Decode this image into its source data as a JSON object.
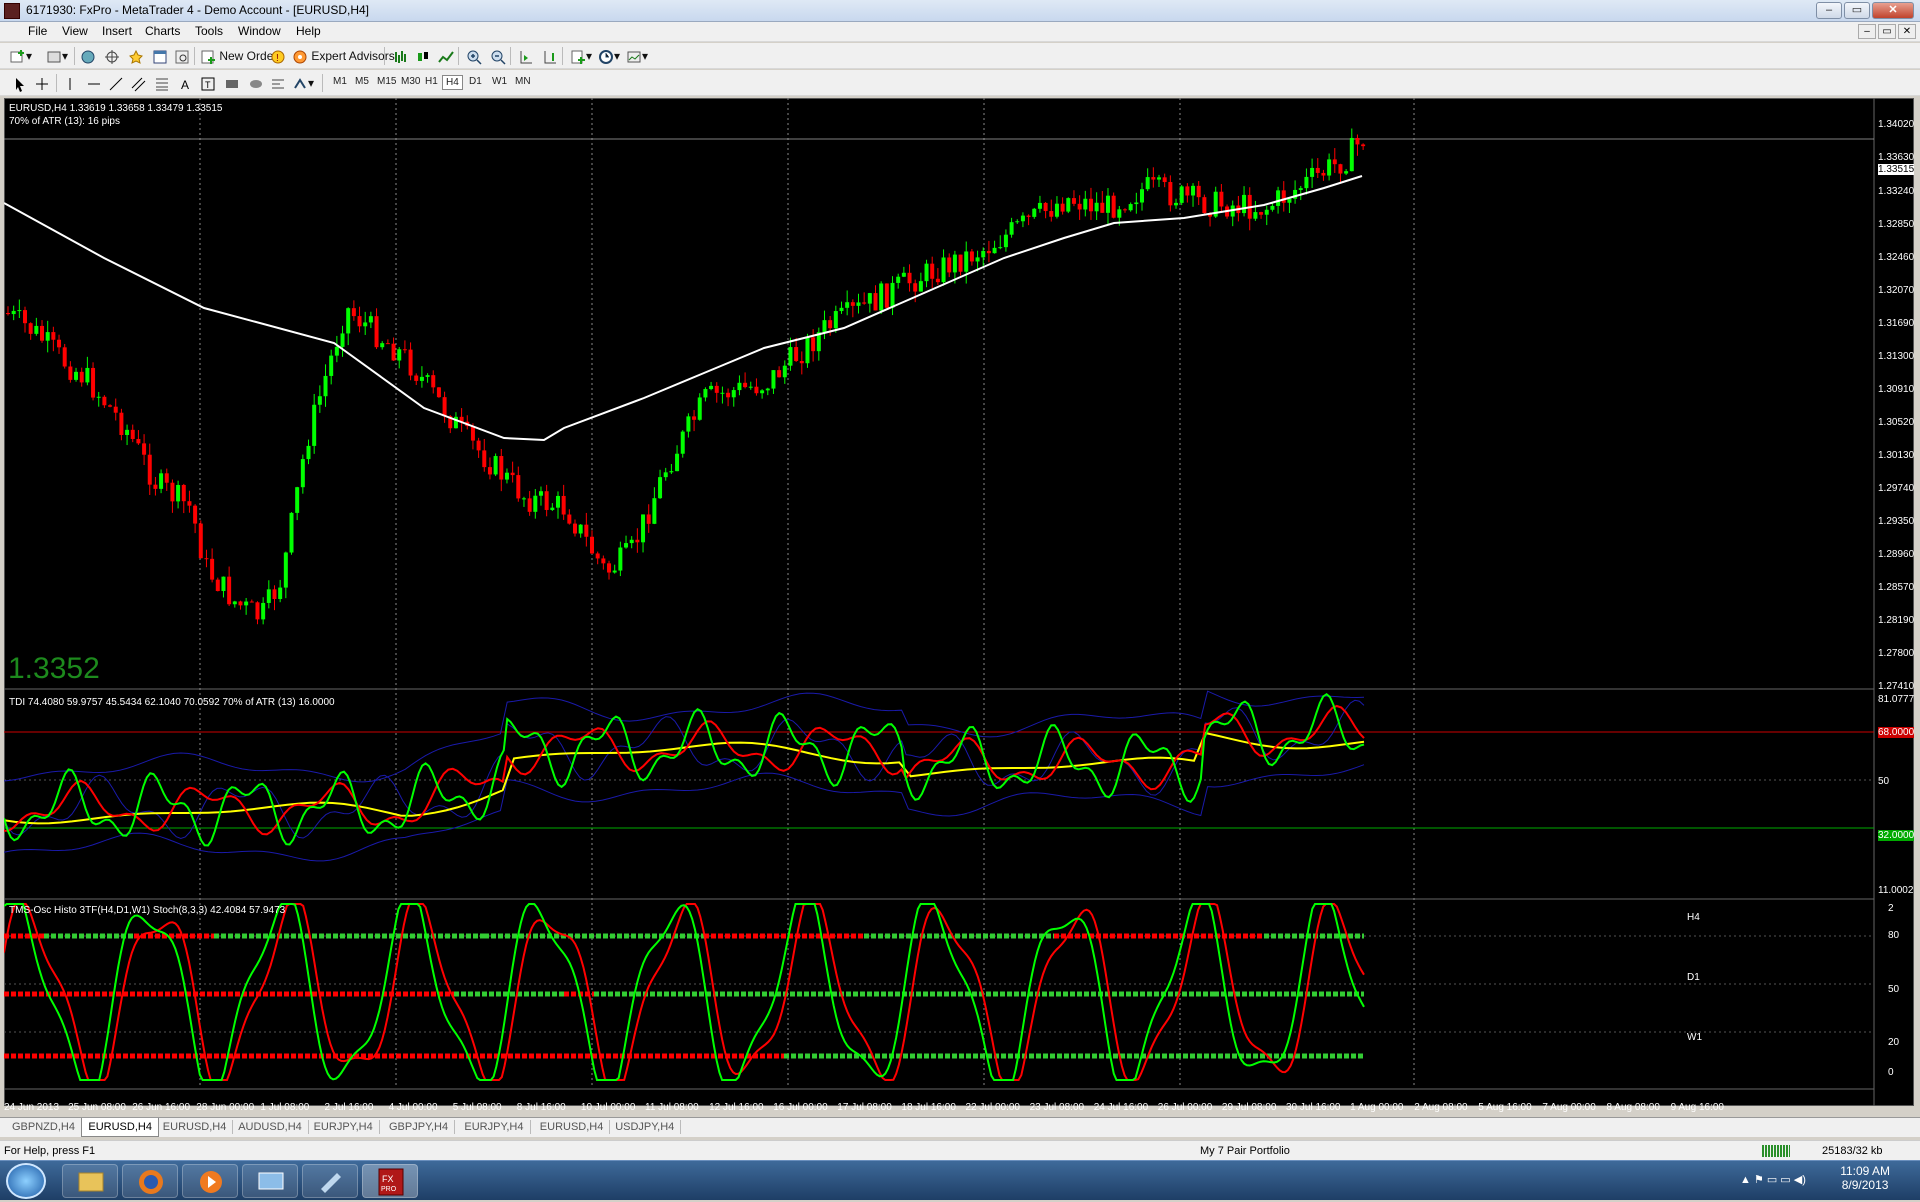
{
  "window": {
    "title": "6171930: FxPro - MetaTrader 4 - Demo Account - [EURUSD,H4]",
    "buttons": [
      "–",
      "▭",
      "✕"
    ]
  },
  "menu": [
    "File",
    "View",
    "Insert",
    "Charts",
    "Tools",
    "Window",
    "Help"
  ],
  "toolbar": {
    "new_order": "New Order",
    "expert_advisors": "Expert Advisors",
    "timeframes": [
      "M1",
      "M5",
      "M15",
      "M30",
      "H1",
      "H4",
      "D1",
      "W1",
      "MN"
    ],
    "active_timeframe": "H4"
  },
  "chart": {
    "header": "EURUSD,H4  1.33619 1.33658 1.33479 1.33515",
    "atr_info": "70% of ATR (13): 16 pips",
    "big_price": "1.3352",
    "price_axis": [
      "1.34020",
      "1.33630",
      "1.33515",
      "1.33240",
      "1.32850",
      "1.32460",
      "1.32070",
      "1.31690",
      "1.31300",
      "1.30910",
      "1.30520",
      "1.30130",
      "1.29740",
      "1.29350",
      "1.28960",
      "1.28570",
      "1.28190",
      "1.27800",
      "1.27410"
    ],
    "current_price_tag": "1.33515",
    "tdi_label": "TDI 74.4080 59.9757 45.5434 62.1040 70.0592  70% of ATR (13) 16.0000",
    "tdi_axis": [
      "81.0777",
      "68.0000",
      "50",
      "32.0000",
      "11.0002"
    ],
    "tms_label": "TMS-Osc Histo 3TF(H4,D1,W1)  Stoch(8,3,3) 42.4084 57.9473",
    "tms_axis": [
      "2",
      "80",
      "50",
      "20",
      "0"
    ],
    "tms_tf_labels": [
      "H4",
      "D1",
      "W1"
    ],
    "time_axis": [
      "24 Jun 2013",
      "25 Jun 08:00",
      "26 Jun 16:00",
      "28 Jun 00:00",
      "1 Jul 08:00",
      "2 Jul 16:00",
      "4 Jul 00:00",
      "5 Jul 08:00",
      "8 Jul 16:00",
      "10 Jul 00:00",
      "11 Jul 08:00",
      "12 Jul 16:00",
      "16 Jul 00:00",
      "17 Jul 08:00",
      "18 Jul 16:00",
      "22 Jul 00:00",
      "23 Jul 08:00",
      "24 Jul 16:00",
      "26 Jul 00:00",
      "29 Jul 08:00",
      "30 Jul 16:00",
      "1 Aug 00:00",
      "2 Aug 08:00",
      "5 Aug 16:00",
      "7 Aug 00:00",
      "8 Aug 08:00",
      "9 Aug 16:00"
    ],
    "colors": {
      "bull": "#00ff00",
      "bear": "#ff0000",
      "ma": "#ffffff",
      "tdi_price": "#00ff00",
      "tdi_signal": "#ff0000",
      "tdi_market": "#ffff00",
      "tdi_band": "#1a1aaa"
    }
  },
  "tabs": [
    "GBPNZD,H4",
    "EURUSD,H4",
    "EURUSD,H4",
    "AUDUSD,H4",
    "EURJPY,H4",
    "GBPJPY,H4",
    "EURJPY,H4",
    "EURUSD,H4",
    "USDJPY,H4"
  ],
  "active_tab": 1,
  "status": {
    "help": "For Help, press F1",
    "profile": "My 7 Pair Portfolio",
    "traffic": "25183/32 kb"
  },
  "taskbar": {
    "time": "11:09 AM",
    "date": "8/9/2013"
  }
}
